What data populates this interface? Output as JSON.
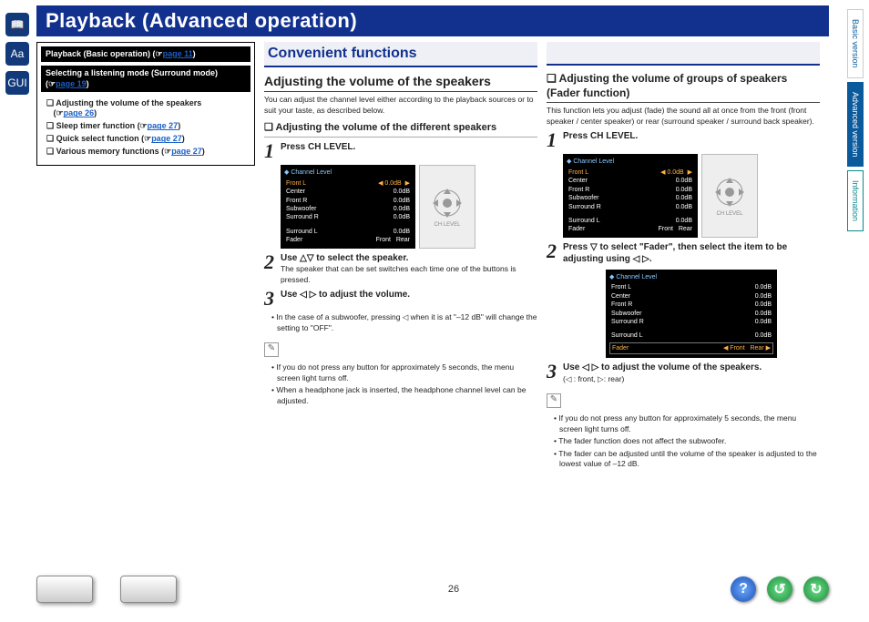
{
  "sidebar": {
    "icon1": "📖",
    "icon2": "Aa",
    "icon3": "GUI"
  },
  "right_tabs": {
    "basic": "Basic version",
    "advanced": "Advanced version",
    "info": "Information"
  },
  "title": "Playback (Advanced operation)",
  "nav": {
    "playback_basic": "Playback (Basic operation)",
    "playback_basic_link": "page 11",
    "surround": "Selecting a listening mode (Surround mode)",
    "surround_link": "page 19",
    "items": [
      {
        "l": "Adjusting the volume of the speakers",
        "p": "page 26"
      },
      {
        "l": "Sleep timer function",
        "p": "page 27"
      },
      {
        "l": "Quick select function",
        "p": "page 27"
      },
      {
        "l": "Various memory functions",
        "p": "page 27"
      }
    ]
  },
  "section_header": "Convenient functions",
  "col1": {
    "h1": "Adjusting the volume of the speakers",
    "intro": "You can adjust the channel level either according to the playback sources or to suit your taste, as described below.",
    "h2": "❏ Adjusting the volume of the different speakers",
    "step1_pre": "Press ",
    "step1_b": "CH LEVEL.",
    "osd_title": "Channel Level",
    "osd_rows": [
      {
        "n": "Front L",
        "v": "0.0dB",
        "hl": true,
        "arrow": true
      },
      {
        "n": "Center",
        "v": "0.0dB"
      },
      {
        "n": "Front R",
        "v": "0.0dB"
      },
      {
        "n": "Subwoofer",
        "v": "0.0dB"
      },
      {
        "n": "Surround R",
        "v": "0.0dB"
      }
    ],
    "osd_rows2": [
      {
        "n": "Surround L",
        "v": "0.0dB"
      }
    ],
    "osd_fader": {
      "l": "Fader",
      "a": "Front",
      "b": "Rear"
    },
    "step2_b": "Use △▽ to select the speaker.",
    "step2_t": "The speaker that can be set switches each time one of the buttons is pressed.",
    "step3_b": "Use ◁ ▷ to adjust the volume.",
    "bullet1": "In the case of a subwoofer, pressing ◁ when it is at \"–12 dB\" will change the setting to \"OFF\".",
    "note1": "If you do not press any button for approximately 5 seconds, the menu screen light turns off.",
    "note2": "When a headphone jack is inserted, the headphone channel level can be adjusted."
  },
  "col2": {
    "h1": "❏ Adjusting the volume of groups of speakers (Fader function)",
    "intro": "This function lets you adjust (fade) the sound all at once from the front (front speaker / center speaker) or rear (surround speaker / surround back speaker).",
    "step1_pre": "Press ",
    "step1_b": "CH LEVEL.",
    "osd_title": "Channel Level",
    "osd_rows": [
      {
        "n": "Front L",
        "v": "0.0dB",
        "hl": true,
        "arrow": true
      },
      {
        "n": "Center",
        "v": "0.0dB"
      },
      {
        "n": "Front R",
        "v": "0.0dB"
      },
      {
        "n": "Subwoofer",
        "v": "0.0dB"
      },
      {
        "n": "Surround R",
        "v": "0.0dB"
      }
    ],
    "osd_rows2": [
      {
        "n": "Surround L",
        "v": "0.0dB"
      }
    ],
    "osd_fader": {
      "l": "Fader",
      "a": "Front",
      "b": "Rear"
    },
    "step2_b": "Press ▽ to select \"Fader\", then select the item to be adjusting using ◁ ▷.",
    "osd2_title": "Channel Level",
    "osd2_rows": [
      {
        "n": "Front L",
        "v": "0.0dB"
      },
      {
        "n": "Center",
        "v": "0.0dB"
      },
      {
        "n": "Front R",
        "v": "0.0dB"
      },
      {
        "n": "Subwoofer",
        "v": "0.0dB"
      },
      {
        "n": "Surround R",
        "v": "0.0dB"
      }
    ],
    "osd2_sl": {
      "n": "Surround L",
      "v": "0.0dB"
    },
    "osd2_fader": {
      "l": "Fader",
      "a": "Front",
      "b": "Rear"
    },
    "step3_b": "Use ◁ ▷ to adjust the volume of the speakers.",
    "step3_t": "(◁ : front, ▷: rear)",
    "note1": "If you do not press any button for approximately 5 seconds, the menu screen light turns off.",
    "note2": "The fader function does not affect the subwoofer.",
    "note3": "The fader can be adjusted until the volume of the speaker is adjusted to the lowest value of –12 dB."
  },
  "footer": {
    "page": "26",
    "help": "?",
    "back": "↺",
    "fwd": "↻"
  }
}
